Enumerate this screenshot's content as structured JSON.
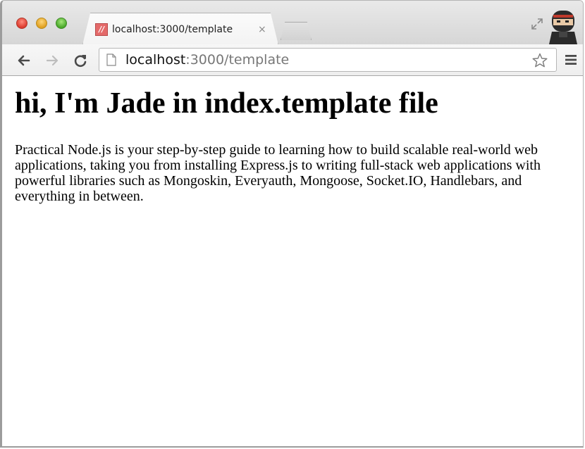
{
  "browser": {
    "tab": {
      "favicon_glyph": "//",
      "title": "localhost:3000/template",
      "close_glyph": "×"
    },
    "address_bar": {
      "host": "localhost",
      "path": ":3000/template"
    },
    "icons": {
      "back": "arrow-left-icon",
      "forward": "arrow-right-icon",
      "reload": "reload-icon",
      "page": "page-icon",
      "bookmark": "star-icon",
      "menu": "hamburger-menu-icon",
      "fullscreen": "fullscreen-icon",
      "profile": "ninja-avatar-icon"
    },
    "colors": {
      "close": "#dc3b2e",
      "minimize": "#e0a021",
      "maximize": "#49a82a",
      "favicon": "#e46a6a"
    }
  },
  "page": {
    "heading": "hi, I'm Jade in index.template file",
    "paragraph": "Practical Node.js is your step-by-step guide to learning how to build scalable real-world web applications, taking you from installing Express.js to writing full-stack web applications with powerful libraries such as Mongoskin, Everyauth, Mongoose, Socket.IO, Handlebars, and everything in between."
  }
}
